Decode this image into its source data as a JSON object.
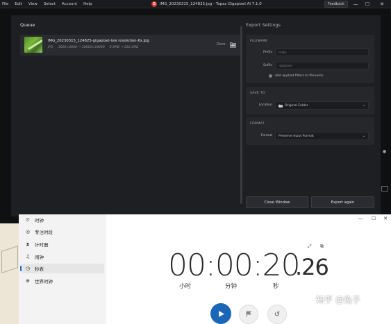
{
  "topbar": {
    "menu": [
      "File",
      "Edit",
      "View",
      "Select",
      "Account",
      "Help"
    ],
    "title": "IMG_20230315_124825.jpg - Topaz Gigapixel AI 7.1.0",
    "logo_letter": "G",
    "feedback_label": "Feedback",
    "minimize": "—",
    "maximize": "☐",
    "close": "✕"
  },
  "dialog": {
    "queue_title": "Queue",
    "queue_item": {
      "name": "IMG_20230315_124825-gigapixel-low resolution-6x.jpg",
      "format": "JPG",
      "dimensions": "3000×4000 → 18000×24000",
      "size": "8.9MB → 282.2MB",
      "status": "Done"
    },
    "settings_title": "Export Settings",
    "filename": {
      "heading": "FILENAME",
      "prefix_label": "Prefix",
      "prefix_placeholder": "Prefix",
      "suffix_label": "Suffix",
      "suffix_placeholder": "-gigapixel",
      "applied_filters_label": "Add applied filters to filename"
    },
    "save_to": {
      "heading": "SAVE TO",
      "location_label": "Location",
      "location_value": "Original Folder"
    },
    "format": {
      "heading": "FORMAT",
      "format_label": "Format",
      "format_value": "Preserve Input Format"
    },
    "close_window_label": "Close Window",
    "export_again_label": "Export again"
  },
  "clock": {
    "nav": [
      {
        "label": "时钟",
        "icon": "alarm-icon"
      },
      {
        "label": "专注时段",
        "icon": "focus-icon"
      },
      {
        "label": "计时器",
        "icon": "hourglass-icon"
      },
      {
        "label": "闹钟",
        "icon": "bell-icon"
      },
      {
        "label": "秒表",
        "icon": "stopwatch-icon"
      },
      {
        "label": "世界时钟",
        "icon": "globe-icon"
      }
    ],
    "active_nav": 4,
    "time_main": "00:00:20",
    "time_fraction": ".26",
    "unit_hours": "小时",
    "unit_minutes": "分钟",
    "unit_seconds": "秒"
  },
  "watermark": "知乎 @兔子",
  "colors": {
    "accent_blue": "#1a67b8",
    "topaz_red": "#d8362a"
  }
}
